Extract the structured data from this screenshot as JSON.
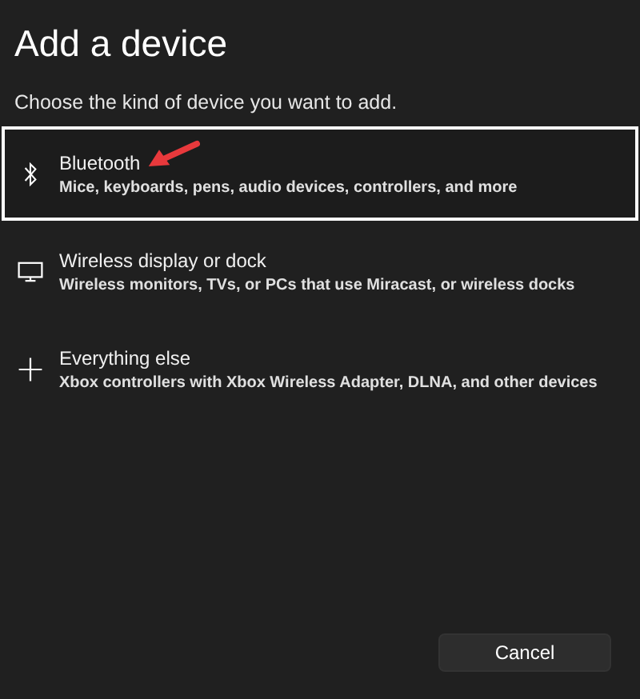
{
  "title": "Add a device",
  "subtitle": "Choose the kind of device you want to add.",
  "devices": [
    {
      "kind": "bluetooth",
      "name": "Bluetooth",
      "description": "Mice, keyboards, pens, audio devices, controllers, and more",
      "selected": true,
      "annotated": true
    },
    {
      "kind": "display",
      "name": "Wireless display or dock",
      "description": "Wireless monitors, TVs, or PCs that use Miracast, or wireless docks",
      "selected": false,
      "annotated": false
    },
    {
      "kind": "other",
      "name": "Everything else",
      "description": "Xbox controllers with Xbox Wireless Adapter, DLNA, and other devices",
      "selected": false,
      "annotated": false
    }
  ],
  "buttons": [
    "Cancel"
  ]
}
